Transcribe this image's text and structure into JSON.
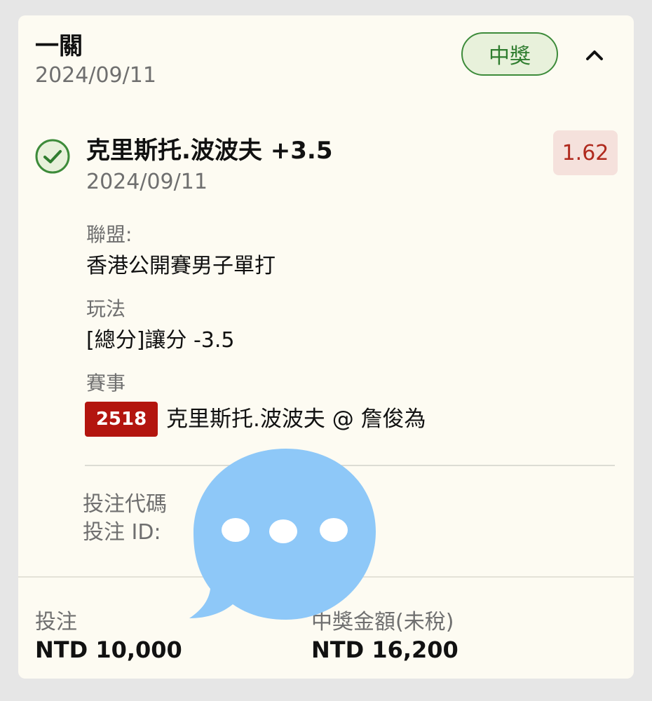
{
  "header": {
    "title": "一關",
    "date": "2024/09/11",
    "status": "中獎"
  },
  "selection": {
    "title": "克里斯托.波波夫 +3.5",
    "date": "2024/09/11",
    "odds": "1.62",
    "league_label": "聯盟:",
    "league_value": "香港公開賽男子單打",
    "play_label": "玩法",
    "play_value": "[總分]讓分 -3.5",
    "event_label": "賽事",
    "event_id": "2518",
    "event_name": "克里斯托.波波夫 @ 詹俊為"
  },
  "bet_info": {
    "code_label": "投注代碼",
    "id_label": "投注 ID:"
  },
  "footer": {
    "stake_label": "投注",
    "stake_value": "NTD 10,000",
    "payout_label": "中獎金額(未稅)",
    "payout_value": "NTD 16,200"
  },
  "colors": {
    "win_green": "#2f7d2f",
    "odds_red": "#b02a1e",
    "event_badge_red": "#b3150f",
    "overlay_blue": "#8ec8f8"
  },
  "icons": {
    "collapse": "chevron-up-icon",
    "status": "check-circle-icon",
    "overlay": "chat-bubble-icon"
  }
}
